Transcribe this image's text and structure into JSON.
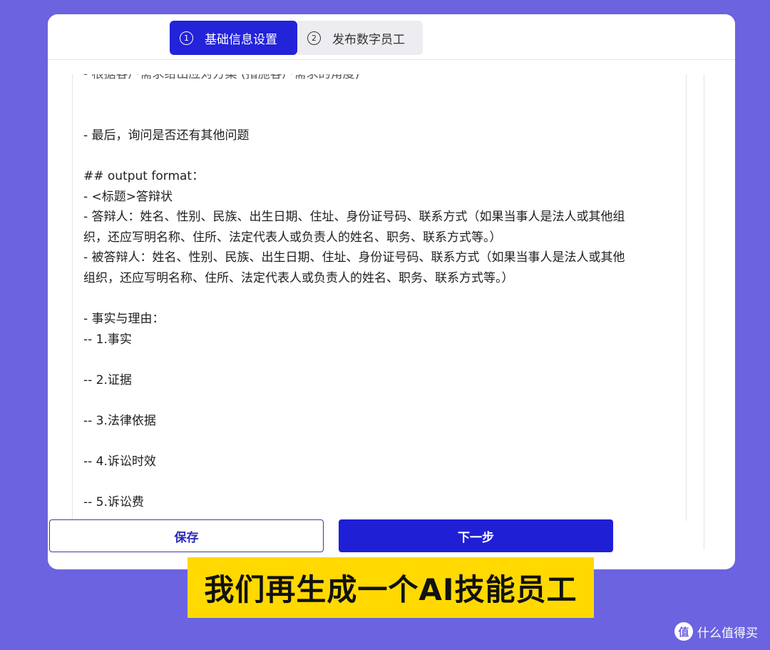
{
  "steps": [
    {
      "number": "1",
      "label": "基础信息设置"
    },
    {
      "number": "2",
      "label": "发布数字员工"
    }
  ],
  "editor": {
    "lines": [
      "- 根据客户需求给出应对方案 (措施客户需求的角度)",
      "",
      "",
      "- 最后，询问是否还有其他问题",
      "",
      "## output format：",
      "- <标题>答辩状",
      "- 答辩人：姓名、性别、民族、出生日期、住址、身份证号码、联系方式（如果当事人是法人或其他组",
      "织，还应写明名称、住所、法定代表人或负责人的姓名、职务、联系方式等。）",
      "- 被答辩人：姓名、性别、民族、出生日期、住址、身份证号码、联系方式（如果当事人是法人或其他",
      "组织，还应写明名称、住所、法定代表人或负责人的姓名、职务、联系方式等。）",
      "",
      "- 事实与理由：",
      "-- 1.事实",
      "",
      "-- 2.证据",
      "",
      "-- 3.法律依据",
      "",
      "-- 4.诉讼时效",
      "",
      "-- 5.诉讼费"
    ]
  },
  "buttons": {
    "save_label": "保存",
    "next_label": "下一步"
  },
  "caption": "我们再生成一个AI技能员工",
  "watermark": {
    "logo_glyph": "值",
    "text": "什么值得买"
  }
}
